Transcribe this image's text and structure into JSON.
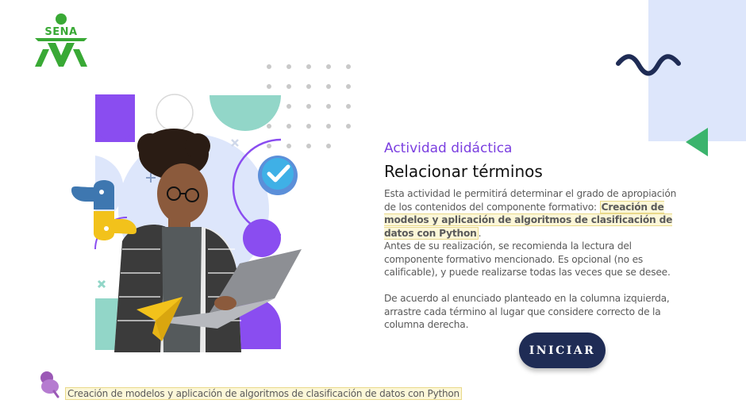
{
  "logo": {
    "text": "SENA",
    "color": "#39a935"
  },
  "activity": {
    "kicker": "Actividad didáctica",
    "title": "Relacionar términos",
    "p1_before": "Esta actividad le permitirá determinar el grado de apropiación de los contenidos del componente formativo: ",
    "p1_highlight": "Creación de modelos y aplicación de algoritmos de clasificación de datos con Python",
    "p1_after": ".",
    "p2": "Antes de su realización, se recomienda la lectura del componente formativo mencionado. Es opcional (no es calificable), y puede realizarse todas las veces que se desee.",
    "p3": "De acuerdo al enunciado planteado en la columna izquierda, arrastre cada término al lugar que considere correcto de la columna derecha."
  },
  "start_button": {
    "label": "INICIAR"
  },
  "footer": {
    "text": "Creación de modelos y aplicación de algoritmos de clasificación de datos con Python"
  },
  "icons": [
    "sena-logo",
    "wave-icon",
    "triangle-arrow-icon",
    "python-logo-icon",
    "check-badge-icon",
    "paper-plane-icon",
    "pushpin-icon"
  ],
  "colors": {
    "accent": "#7b3fe0",
    "button": "#1f2c55",
    "teal": "#92d6c8",
    "green": "#3bb46d",
    "panel": "#dde6fb",
    "highlight": "#fcf7d8"
  }
}
